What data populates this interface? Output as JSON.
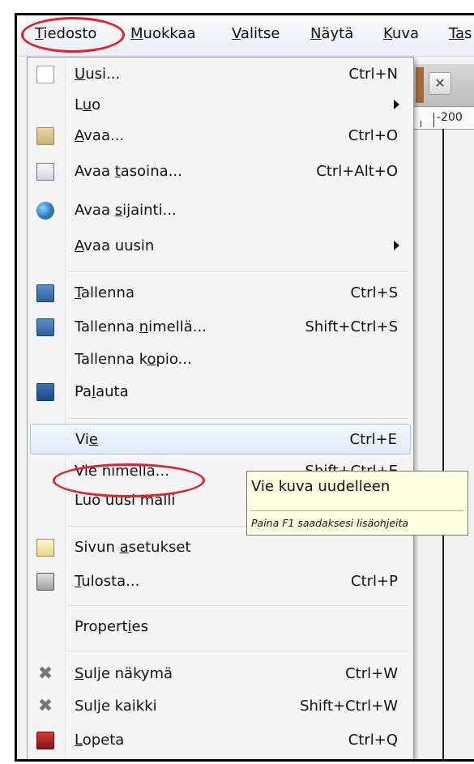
{
  "menubar": {
    "items": [
      {
        "first": "T",
        "rest": "iedosto"
      },
      {
        "first": "M",
        "rest": "uokkaa"
      },
      {
        "first": "V",
        "rest": "alitse"
      },
      {
        "first": "N",
        "rest": "äytä"
      },
      {
        "first": "K",
        "rest": "uva"
      },
      {
        "first": "Ta",
        "rest": "s"
      }
    ]
  },
  "background": {
    "ruler_label": "-200",
    "close_glyph": "✕"
  },
  "menu": {
    "new": {
      "u": "U",
      "rest": "usi...",
      "shortcut": "Ctrl+N",
      "icon": "new-document-icon"
    },
    "create": {
      "pre": "L",
      "u": "u",
      "rest": "o"
    },
    "open": {
      "u": "A",
      "rest": "vaa...",
      "shortcut": "Ctrl+O",
      "icon": "folder-icon"
    },
    "open_layers": {
      "pre": "Avaa ",
      "u": "t",
      "rest": "asoina...",
      "shortcut": "Ctrl+Alt+O",
      "icon": "layers-icon"
    },
    "open_location": {
      "pre": "Avaa ",
      "u": "s",
      "rest": "ijainti...",
      "icon": "globe-icon"
    },
    "open_recent": {
      "u": "A",
      "rest": "vaa uusin"
    },
    "save": {
      "u": "T",
      "rest": "allenna",
      "shortcut": "Ctrl+S",
      "icon": "save-icon"
    },
    "save_as": {
      "pre": "Tallenna ",
      "u": "n",
      "rest": "imellä...",
      "shortcut": "Shift+Ctrl+S",
      "icon": "save-as-icon"
    },
    "save_copy": {
      "pre": "Tallenna k",
      "u": "o",
      "rest": "pio..."
    },
    "revert": {
      "pre": "Pa",
      "u": "l",
      "rest": "auta",
      "icon": "revert-icon"
    },
    "export": {
      "pre": "Vi",
      "u": "e",
      "rest": "",
      "shortcut": "Ctrl+E"
    },
    "export_as": {
      "label": "Vie nimellä...",
      "shortcut": "Shift+Ctrl+E"
    },
    "create_template": {
      "label": "Luo uusi malli"
    },
    "page_setup": {
      "pre": "Sivun ",
      "u": "a",
      "rest": "setukset",
      "icon": "page-setup-icon"
    },
    "print": {
      "u": "T",
      "rest": "ulosta...",
      "shortcut": "Ctrl+P",
      "icon": "printer-icon"
    },
    "properties": {
      "pre": "Propert",
      "u": "i",
      "rest": "es"
    },
    "close_view": {
      "u": "S",
      "rest": "ulje näkymä",
      "shortcut": "Ctrl+W",
      "icon": "close-x-icon"
    },
    "close_all": {
      "label": "Sulje kaikki",
      "shortcut": "Shift+Ctrl+W",
      "icon": "close-x-icon"
    },
    "quit": {
      "u": "L",
      "rest": "opeta",
      "shortcut": "Ctrl+Q",
      "icon": "quit-icon"
    }
  },
  "tooltip": {
    "title": "Vie kuva uudelleen",
    "hint": "Paina F1 saadaksesi lisäohjeita"
  },
  "colors": {
    "annotation_red": "#e0222c",
    "tooltip_bg": "#ffffe1",
    "highlight_border": "#aac4e6"
  }
}
